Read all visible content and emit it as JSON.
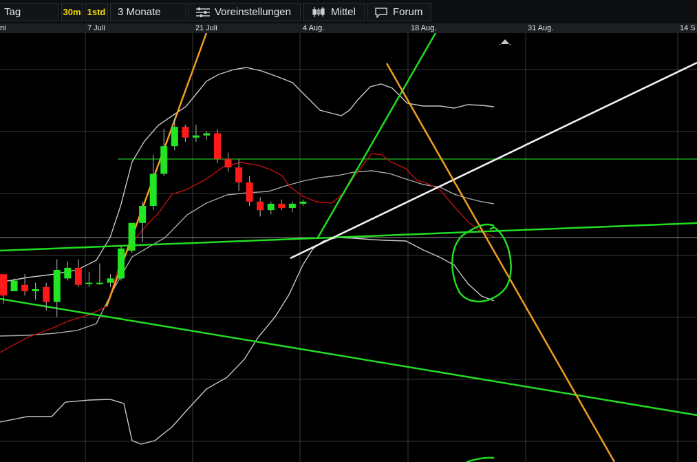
{
  "toolbar": {
    "period_label": "Tag",
    "interval_30m": "30m",
    "interval_1std": "1std",
    "range_label": "3 Monate",
    "settings_label": "Voreinstellungen",
    "type_label": "Mittel",
    "forum_label": "Forum"
  },
  "chart_data": {
    "type": "candlestick",
    "x_tick_labels": [
      "ni",
      "7 Juli",
      "21 Juli",
      "4 Aug.",
      "18 Aug.",
      "31 Aug.",
      "14 S"
    ],
    "grid": true,
    "colors": {
      "up": "#22e622",
      "down": "#ff1a1a",
      "ma": "#c01010",
      "bands": "#bdbdbd"
    },
    "candles": [
      {
        "o": 0.88,
        "h": 0.87,
        "l": 0.74,
        "c": 0.78
      },
      {
        "o": 0.8,
        "h": 0.86,
        "l": 0.8,
        "c": 0.85
      },
      {
        "o": 0.83,
        "h": 0.88,
        "l": 0.78,
        "c": 0.8
      },
      {
        "o": 0.8,
        "h": 0.84,
        "l": 0.76,
        "c": 0.81
      },
      {
        "o": 0.82,
        "h": 0.84,
        "l": 0.71,
        "c": 0.75
      },
      {
        "o": 0.75,
        "h": 0.95,
        "l": 0.68,
        "c": 0.9
      },
      {
        "o": 0.86,
        "h": 0.94,
        "l": 0.85,
        "c": 0.91
      },
      {
        "o": 0.91,
        "h": 0.95,
        "l": 0.82,
        "c": 0.83
      },
      {
        "o": 0.84,
        "h": 0.89,
        "l": 0.82,
        "c": 0.84
      },
      {
        "o": 0.84,
        "h": 0.93,
        "l": 0.83,
        "c": 0.84
      },
      {
        "o": 0.84,
        "h": 0.88,
        "l": 0.82,
        "c": 0.86
      },
      {
        "o": 0.86,
        "h": 1.01,
        "l": 0.85,
        "c": 1.0
      },
      {
        "o": 0.99,
        "h": 1.12,
        "l": 0.98,
        "c": 1.12
      },
      {
        "o": 1.12,
        "h": 1.22,
        "l": 1.03,
        "c": 1.2
      },
      {
        "o": 1.2,
        "h": 1.44,
        "l": 1.18,
        "c": 1.35
      },
      {
        "o": 1.35,
        "h": 1.56,
        "l": 1.34,
        "c": 1.48
      },
      {
        "o": 1.48,
        "h": 1.61,
        "l": 1.46,
        "c": 1.57
      },
      {
        "o": 1.57,
        "h": 1.58,
        "l": 1.5,
        "c": 1.52
      },
      {
        "o": 1.52,
        "h": 1.58,
        "l": 1.5,
        "c": 1.53
      },
      {
        "o": 1.53,
        "h": 1.55,
        "l": 1.51,
        "c": 1.54
      },
      {
        "o": 1.54,
        "h": 1.56,
        "l": 1.4,
        "c": 1.42
      },
      {
        "o": 1.42,
        "h": 1.45,
        "l": 1.36,
        "c": 1.38
      },
      {
        "o": 1.38,
        "h": 1.42,
        "l": 1.27,
        "c": 1.31
      },
      {
        "o": 1.31,
        "h": 1.34,
        "l": 1.2,
        "c": 1.22
      },
      {
        "o": 1.22,
        "h": 1.24,
        "l": 1.15,
        "c": 1.18
      },
      {
        "o": 1.18,
        "h": 1.22,
        "l": 1.16,
        "c": 1.21
      },
      {
        "o": 1.21,
        "h": 1.23,
        "l": 1.18,
        "c": 1.19
      },
      {
        "o": 1.19,
        "h": 1.22,
        "l": 1.17,
        "c": 1.21
      },
      {
        "o": 1.21,
        "h": 1.23,
        "l": 1.2,
        "c": 1.22
      }
    ]
  }
}
